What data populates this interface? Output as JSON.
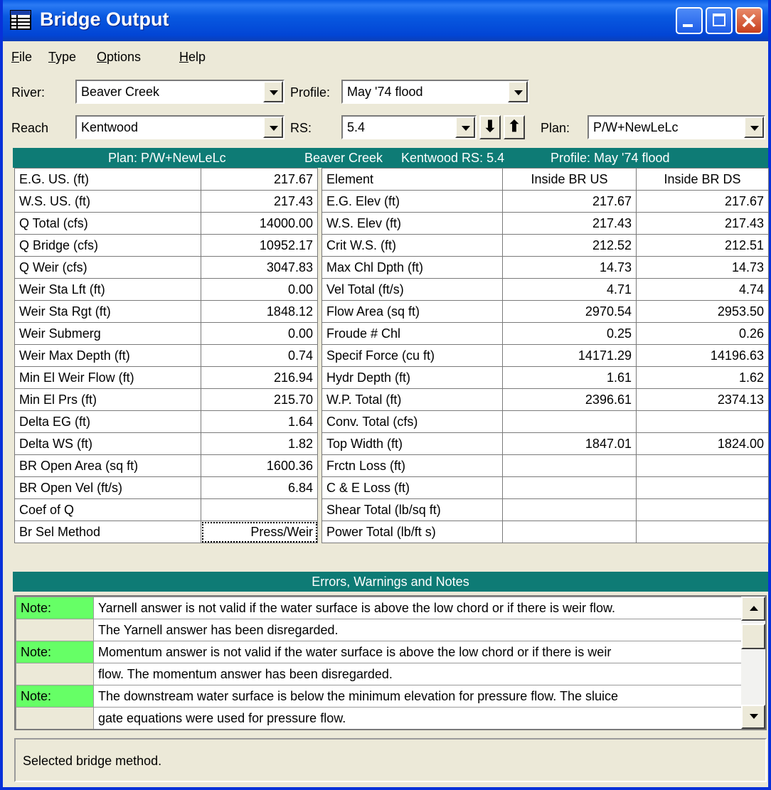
{
  "window": {
    "title": "Bridge Output"
  },
  "menu": [
    "File",
    "Type",
    "Options",
    "Help"
  ],
  "selectors": {
    "river_label": "River:",
    "river_value": "Beaver Creek",
    "profile_label": "Profile:",
    "profile_value": "May '74 flood",
    "reach_label": "Reach",
    "reach_value": "Kentwood",
    "rs_label": "RS:",
    "rs_value": "5.4",
    "plan_label": "Plan:",
    "plan_value": "P/W+NewLeLc"
  },
  "banner": {
    "plan": "Plan: P/W+NewLeLc",
    "river": "Beaver Creek",
    "reach_rs": "Kentwood  RS: 5.4",
    "profile": "Profile: May '74 flood"
  },
  "left_table": [
    [
      "E.G. US. (ft)",
      "217.67"
    ],
    [
      "W.S. US. (ft)",
      "217.43"
    ],
    [
      "Q Total (cfs)",
      "14000.00"
    ],
    [
      "Q Bridge (cfs)",
      "10952.17"
    ],
    [
      "Q Weir (cfs)",
      "3047.83"
    ],
    [
      "Weir Sta Lft (ft)",
      "0.00"
    ],
    [
      "Weir Sta Rgt (ft)",
      "1848.12"
    ],
    [
      "Weir Submerg",
      "0.00"
    ],
    [
      "Weir Max Depth (ft)",
      "0.74"
    ],
    [
      "Min El Weir Flow (ft)",
      "216.94"
    ],
    [
      "Min El Prs (ft)",
      "215.70"
    ],
    [
      "Delta EG (ft)",
      "1.64"
    ],
    [
      "Delta WS (ft)",
      "1.82"
    ],
    [
      "BR Open Area (sq ft)",
      "1600.36"
    ],
    [
      "BR Open Vel (ft/s)",
      "6.84"
    ],
    [
      "Coef of Q",
      ""
    ],
    [
      "Br Sel Method",
      "Press/Weir"
    ]
  ],
  "right_table": {
    "headers": [
      "Element",
      "Inside BR US",
      "Inside BR DS"
    ],
    "rows": [
      [
        "E.G. Elev (ft)",
        "217.67",
        "217.67"
      ],
      [
        "W.S. Elev (ft)",
        "217.43",
        "217.43"
      ],
      [
        "Crit W.S. (ft)",
        "212.52",
        "212.51"
      ],
      [
        "Max Chl Dpth (ft)",
        "14.73",
        "14.73"
      ],
      [
        "Vel Total (ft/s)",
        "4.71",
        "4.74"
      ],
      [
        "Flow Area (sq ft)",
        "2970.54",
        "2953.50"
      ],
      [
        "Froude # Chl",
        "0.25",
        "0.26"
      ],
      [
        "Specif Force (cu ft)",
        "14171.29",
        "14196.63"
      ],
      [
        "Hydr Depth (ft)",
        "1.61",
        "1.62"
      ],
      [
        "W.P. Total (ft)",
        "2396.61",
        "2374.13"
      ],
      [
        "Conv. Total (cfs)",
        "",
        ""
      ],
      [
        "Top Width (ft)",
        "1847.01",
        "1824.00"
      ],
      [
        "Frctn Loss (ft)",
        "",
        ""
      ],
      [
        "C & E Loss (ft)",
        "",
        ""
      ],
      [
        "Shear Total (lb/sq ft)",
        "",
        ""
      ],
      [
        "Power Total (lb/ft s)",
        "",
        ""
      ]
    ]
  },
  "notes_title": "Errors, Warnings and Notes",
  "notes": [
    [
      "Note:",
      "Yarnell answer is not valid if the water surface is above the low chord or if there is weir flow."
    ],
    [
      "",
      "The Yarnell answer has been disregarded."
    ],
    [
      "Note:",
      "Momentum answer is not valid if the water surface is above the low chord or if there is weir"
    ],
    [
      "",
      "flow.  The momentum answer has been disregarded."
    ],
    [
      "Note:",
      "The downstream water surface is below the minimum elevation for pressure flow.  The sluice"
    ],
    [
      "",
      "gate equations were used for pressure flow."
    ]
  ],
  "status": "Selected bridge method.",
  "colors": {
    "banner": "#0e7b75",
    "note_tag": "#66ff66",
    "titlebar": "#0245d5"
  }
}
